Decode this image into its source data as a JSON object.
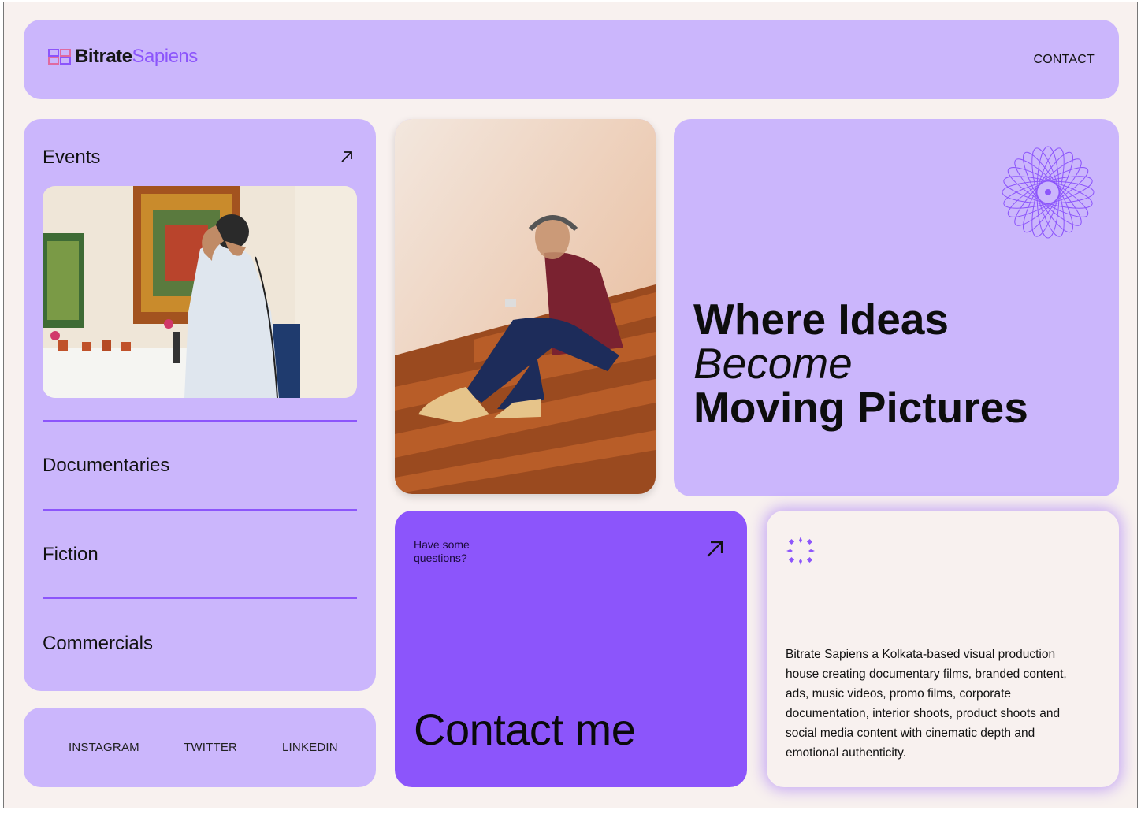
{
  "brand": {
    "name_part1": "Bitrate",
    "name_part2": "Sapiens",
    "accent_color": "#8c55fb",
    "card_color": "#cbb6fc"
  },
  "nav": {
    "contact_label": "CONTACT"
  },
  "categories": [
    {
      "label": "Events",
      "icon": "arrow-up-right-icon"
    },
    {
      "label": "Documentaries"
    },
    {
      "label": "Fiction"
    },
    {
      "label": "Commercials"
    }
  ],
  "social": [
    "INSTAGRAM",
    "TWITTER",
    "LINKEDIN"
  ],
  "hero": {
    "line1": "Where Ideas",
    "line2": "Become",
    "line3": "Moving Pictures"
  },
  "contact_card": {
    "question": "Have some questions?",
    "title": "Contact me",
    "icon": "arrow-up-right-icon"
  },
  "about": {
    "icon": "sparkle-ring-icon",
    "text": "Bitrate Sapiens a Kolkata-based visual production house creating documentary films, branded content, ads, music videos, promo films, corporate documentation, interior shoots, product shoots and social media content with cinematic depth and emotional authenticity."
  }
}
